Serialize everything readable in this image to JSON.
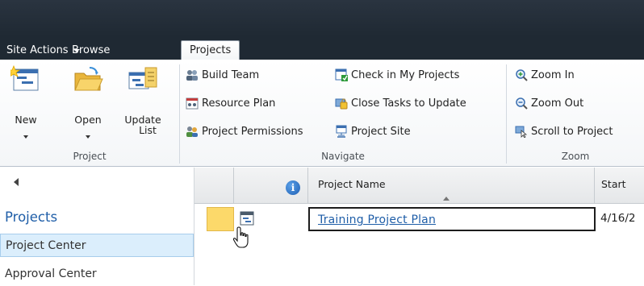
{
  "tabs": {
    "site_actions": "Site Actions",
    "browse": "Browse",
    "projects": "Projects"
  },
  "ribbon": {
    "project_group": {
      "label": "Project",
      "new": "New",
      "open": "Open",
      "update_list_1": "Update",
      "update_list_2": "List"
    },
    "navigate_group": {
      "label": "Navigate",
      "build_team": "Build Team",
      "resource_plan": "Resource Plan",
      "project_permissions": "Project Permissions",
      "check_in": "Check in My Projects",
      "close_tasks": "Close Tasks to Update",
      "project_site": "Project Site"
    },
    "zoom_group": {
      "label": "Zoom",
      "zoom_in": "Zoom In",
      "zoom_out": "Zoom Out",
      "scroll_to_project": "Scroll to Project"
    }
  },
  "leftnav": {
    "heading": "Projects",
    "items": [
      "Project Center",
      "Approval Center"
    ]
  },
  "grid": {
    "columns": [
      "Project Name",
      "Start"
    ],
    "rows": [
      {
        "name": "Training Project Plan",
        "start": "4/16/2"
      }
    ]
  },
  "icons": [
    "new-icon",
    "open-folder-icon",
    "update-list-icon",
    "build-team-icon",
    "resource-plan-icon",
    "permissions-icon",
    "check-in-icon",
    "close-tasks-icon",
    "project-site-icon",
    "zoom-in-icon",
    "zoom-out-icon",
    "scroll-to-project-icon",
    "info-icon",
    "project-type-icon",
    "hand-cursor-icon"
  ]
}
